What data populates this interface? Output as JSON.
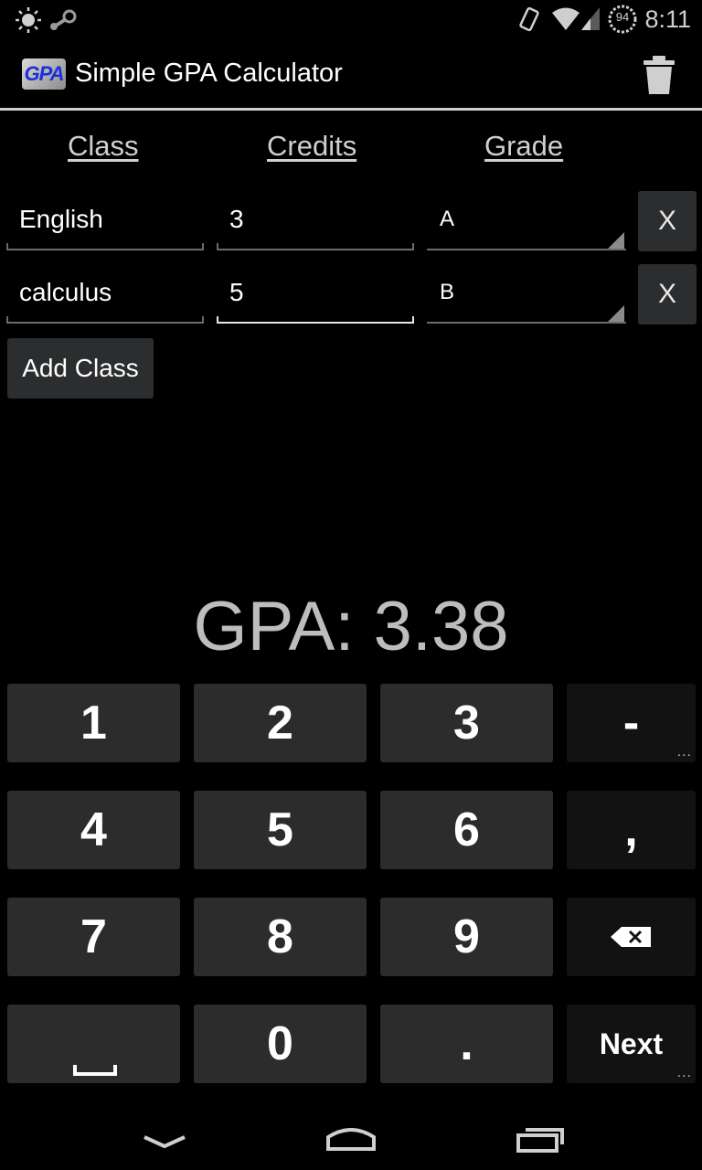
{
  "status_bar": {
    "time": "8:11",
    "battery_level": "94"
  },
  "app": {
    "title": "Simple GPA Calculator",
    "icon_text": "GPA"
  },
  "columns": {
    "class": "Class",
    "credits": "Credits",
    "grade": "Grade"
  },
  "rows": [
    {
      "class": "English",
      "credits": "3",
      "grade": "A",
      "remove_label": "X"
    },
    {
      "class": "calculus",
      "credits": "5",
      "grade": "B",
      "remove_label": "X"
    }
  ],
  "add_class_label": "Add Class",
  "gpa_text": "GPA: 3.38",
  "keypad": {
    "rows": [
      [
        "1",
        "2",
        "3",
        "-"
      ],
      [
        "4",
        "5",
        "6",
        ","
      ],
      [
        "7",
        "8",
        "9",
        "⌫"
      ],
      [
        "␣",
        "0",
        ".",
        "Next"
      ]
    ]
  },
  "colors": {
    "background": "#000000",
    "key": "#2c2c2c",
    "key_dark": "#121212",
    "text_dim": "#cfcfcf"
  }
}
